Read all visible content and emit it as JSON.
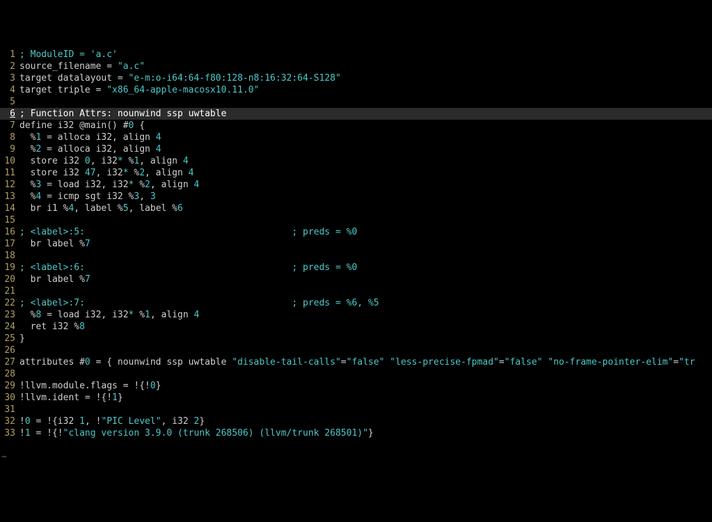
{
  "editor": {
    "highlighted_line": 6,
    "tilde": "~",
    "lines": [
      {
        "n": 1,
        "segments": [
          {
            "c": "c-comment",
            "t": "; ModuleID = 'a.c'"
          }
        ]
      },
      {
        "n": 2,
        "segments": [
          {
            "c": "c-id",
            "t": "source_filename "
          },
          {
            "c": "c-eq",
            "t": "="
          },
          {
            "c": "c-id",
            "t": " "
          },
          {
            "c": "c-str",
            "t": "\"a.c\""
          }
        ]
      },
      {
        "n": 3,
        "segments": [
          {
            "c": "c-id",
            "t": "target datalayout "
          },
          {
            "c": "c-eq",
            "t": "="
          },
          {
            "c": "c-id",
            "t": " "
          },
          {
            "c": "c-str",
            "t": "\"e-m:o-i64:64-f80:128-n8:16:32:64-S128\""
          }
        ]
      },
      {
        "n": 4,
        "segments": [
          {
            "c": "c-id",
            "t": "target triple "
          },
          {
            "c": "c-eq",
            "t": "="
          },
          {
            "c": "c-id",
            "t": " "
          },
          {
            "c": "c-str",
            "t": "\"x86_64-apple-macosx10.11.0\""
          }
        ]
      },
      {
        "n": 5,
        "segments": [
          {
            "c": "c-id",
            "t": ""
          }
        ]
      },
      {
        "n": 6,
        "segments": [
          {
            "c": "c-white",
            "t": "; Function Attrs: nounwind ssp uwtable"
          }
        ]
      },
      {
        "n": 7,
        "segments": [
          {
            "c": "c-id",
            "t": "define i32 @main() #"
          },
          {
            "c": "c-num",
            "t": "0"
          },
          {
            "c": "c-id",
            "t": " {"
          }
        ]
      },
      {
        "n": 8,
        "segments": [
          {
            "c": "c-id",
            "t": "  %"
          },
          {
            "c": "c-num",
            "t": "1"
          },
          {
            "c": "c-id",
            "t": " "
          },
          {
            "c": "c-eq",
            "t": "="
          },
          {
            "c": "c-id",
            "t": " alloca i32, align "
          },
          {
            "c": "c-num",
            "t": "4"
          }
        ]
      },
      {
        "n": 9,
        "segments": [
          {
            "c": "c-id",
            "t": "  %"
          },
          {
            "c": "c-num",
            "t": "2"
          },
          {
            "c": "c-id",
            "t": " "
          },
          {
            "c": "c-eq",
            "t": "="
          },
          {
            "c": "c-id",
            "t": " alloca i32, align "
          },
          {
            "c": "c-num",
            "t": "4"
          }
        ]
      },
      {
        "n": 10,
        "segments": [
          {
            "c": "c-id",
            "t": "  store i32 "
          },
          {
            "c": "c-num",
            "t": "0"
          },
          {
            "c": "c-id",
            "t": ", i32"
          },
          {
            "c": "c-op",
            "t": "*"
          },
          {
            "c": "c-id",
            "t": " %"
          },
          {
            "c": "c-num",
            "t": "1"
          },
          {
            "c": "c-id",
            "t": ", align "
          },
          {
            "c": "c-num",
            "t": "4"
          }
        ]
      },
      {
        "n": 11,
        "segments": [
          {
            "c": "c-id",
            "t": "  store i32 "
          },
          {
            "c": "c-num",
            "t": "47"
          },
          {
            "c": "c-id",
            "t": ", i32"
          },
          {
            "c": "c-op",
            "t": "*"
          },
          {
            "c": "c-id",
            "t": " %"
          },
          {
            "c": "c-num",
            "t": "2"
          },
          {
            "c": "c-id",
            "t": ", align "
          },
          {
            "c": "c-num",
            "t": "4"
          }
        ]
      },
      {
        "n": 12,
        "segments": [
          {
            "c": "c-id",
            "t": "  %"
          },
          {
            "c": "c-num",
            "t": "3"
          },
          {
            "c": "c-id",
            "t": " "
          },
          {
            "c": "c-eq",
            "t": "="
          },
          {
            "c": "c-id",
            "t": " load i32, i32"
          },
          {
            "c": "c-op",
            "t": "*"
          },
          {
            "c": "c-id",
            "t": " %"
          },
          {
            "c": "c-num",
            "t": "2"
          },
          {
            "c": "c-id",
            "t": ", align "
          },
          {
            "c": "c-num",
            "t": "4"
          }
        ]
      },
      {
        "n": 13,
        "segments": [
          {
            "c": "c-id",
            "t": "  %"
          },
          {
            "c": "c-num",
            "t": "4"
          },
          {
            "c": "c-id",
            "t": " "
          },
          {
            "c": "c-eq",
            "t": "="
          },
          {
            "c": "c-id",
            "t": " icmp sgt i32 %"
          },
          {
            "c": "c-num",
            "t": "3"
          },
          {
            "c": "c-id",
            "t": ", "
          },
          {
            "c": "c-num",
            "t": "3"
          }
        ]
      },
      {
        "n": 14,
        "segments": [
          {
            "c": "c-id",
            "t": "  br i1 %"
          },
          {
            "c": "c-num",
            "t": "4"
          },
          {
            "c": "c-id",
            "t": ", label %"
          },
          {
            "c": "c-num",
            "t": "5"
          },
          {
            "c": "c-id",
            "t": ", label %"
          },
          {
            "c": "c-num",
            "t": "6"
          }
        ]
      },
      {
        "n": 15,
        "segments": [
          {
            "c": "c-id",
            "t": ""
          }
        ]
      },
      {
        "n": 16,
        "segments": [
          {
            "c": "c-comment",
            "t": "; <label>:5:                                      ; preds = %0"
          }
        ]
      },
      {
        "n": 17,
        "segments": [
          {
            "c": "c-id",
            "t": "  br label %"
          },
          {
            "c": "c-num",
            "t": "7"
          }
        ]
      },
      {
        "n": 18,
        "segments": [
          {
            "c": "c-id",
            "t": ""
          }
        ]
      },
      {
        "n": 19,
        "segments": [
          {
            "c": "c-comment",
            "t": "; <label>:6:                                      ; preds = %0"
          }
        ]
      },
      {
        "n": 20,
        "segments": [
          {
            "c": "c-id",
            "t": "  br label %"
          },
          {
            "c": "c-num",
            "t": "7"
          }
        ]
      },
      {
        "n": 21,
        "segments": [
          {
            "c": "c-id",
            "t": ""
          }
        ]
      },
      {
        "n": 22,
        "segments": [
          {
            "c": "c-comment",
            "t": "; <label>:7:                                      ; preds = %6, %5"
          }
        ]
      },
      {
        "n": 23,
        "segments": [
          {
            "c": "c-id",
            "t": "  %"
          },
          {
            "c": "c-num",
            "t": "8"
          },
          {
            "c": "c-id",
            "t": " "
          },
          {
            "c": "c-eq",
            "t": "="
          },
          {
            "c": "c-id",
            "t": " load i32, i32"
          },
          {
            "c": "c-op",
            "t": "*"
          },
          {
            "c": "c-id",
            "t": " %"
          },
          {
            "c": "c-num",
            "t": "1"
          },
          {
            "c": "c-id",
            "t": ", align "
          },
          {
            "c": "c-num",
            "t": "4"
          }
        ]
      },
      {
        "n": 24,
        "segments": [
          {
            "c": "c-id",
            "t": "  ret i32 %"
          },
          {
            "c": "c-num",
            "t": "8"
          }
        ]
      },
      {
        "n": 25,
        "segments": [
          {
            "c": "c-id",
            "t": "}"
          }
        ]
      },
      {
        "n": 26,
        "segments": [
          {
            "c": "c-id",
            "t": ""
          }
        ]
      },
      {
        "n": 27,
        "segments": [
          {
            "c": "c-id",
            "t": "attributes #"
          },
          {
            "c": "c-num",
            "t": "0"
          },
          {
            "c": "c-id",
            "t": " "
          },
          {
            "c": "c-eq",
            "t": "="
          },
          {
            "c": "c-id",
            "t": " { nounwind ssp uwtable "
          },
          {
            "c": "c-str",
            "t": "\"disable-tail-calls\""
          },
          {
            "c": "c-eq",
            "t": "="
          },
          {
            "c": "c-str",
            "t": "\"false\""
          },
          {
            "c": "c-id",
            "t": " "
          },
          {
            "c": "c-str",
            "t": "\"less-precise-fpmad\""
          },
          {
            "c": "c-eq",
            "t": "="
          },
          {
            "c": "c-str",
            "t": "\"false\""
          },
          {
            "c": "c-id",
            "t": " "
          },
          {
            "c": "c-str",
            "t": "\"no-frame-pointer-elim\""
          },
          {
            "c": "c-eq",
            "t": "="
          },
          {
            "c": "c-str",
            "t": "\"tr"
          }
        ]
      },
      {
        "n": 28,
        "segments": [
          {
            "c": "c-id",
            "t": ""
          }
        ]
      },
      {
        "n": 29,
        "segments": [
          {
            "c": "c-id",
            "t": "!llvm.module.flags "
          },
          {
            "c": "c-eq",
            "t": "="
          },
          {
            "c": "c-id",
            "t": " !{!"
          },
          {
            "c": "c-num",
            "t": "0"
          },
          {
            "c": "c-id",
            "t": "}"
          }
        ]
      },
      {
        "n": 30,
        "segments": [
          {
            "c": "c-id",
            "t": "!llvm.ident "
          },
          {
            "c": "c-eq",
            "t": "="
          },
          {
            "c": "c-id",
            "t": " !{!"
          },
          {
            "c": "c-num",
            "t": "1"
          },
          {
            "c": "c-id",
            "t": "}"
          }
        ]
      },
      {
        "n": 31,
        "segments": [
          {
            "c": "c-id",
            "t": ""
          }
        ]
      },
      {
        "n": 32,
        "segments": [
          {
            "c": "c-id",
            "t": "!"
          },
          {
            "c": "c-num",
            "t": "0"
          },
          {
            "c": "c-id",
            "t": " "
          },
          {
            "c": "c-eq",
            "t": "="
          },
          {
            "c": "c-id",
            "t": " !{i32 "
          },
          {
            "c": "c-num",
            "t": "1"
          },
          {
            "c": "c-id",
            "t": ", !"
          },
          {
            "c": "c-str",
            "t": "\"PIC Level\""
          },
          {
            "c": "c-id",
            "t": ", i32 "
          },
          {
            "c": "c-num",
            "t": "2"
          },
          {
            "c": "c-id",
            "t": "}"
          }
        ]
      },
      {
        "n": 33,
        "segments": [
          {
            "c": "c-id",
            "t": "!"
          },
          {
            "c": "c-num",
            "t": "1"
          },
          {
            "c": "c-id",
            "t": " "
          },
          {
            "c": "c-eq",
            "t": "="
          },
          {
            "c": "c-id",
            "t": " !{!"
          },
          {
            "c": "c-str",
            "t": "\"clang version 3.9.0 (trunk 268506) (llvm/trunk 268501)\""
          },
          {
            "c": "c-id",
            "t": "}"
          }
        ]
      }
    ]
  }
}
